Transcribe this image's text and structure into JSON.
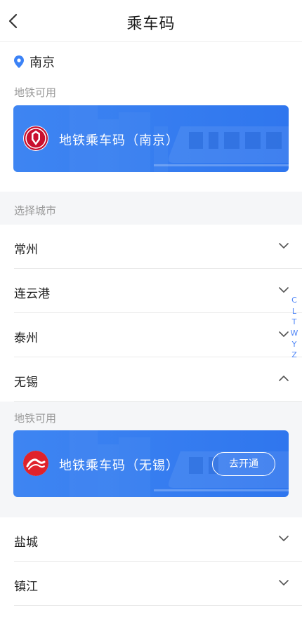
{
  "header": {
    "title": "乘车码"
  },
  "location": {
    "city": "南京"
  },
  "current_card": {
    "section_label": "地铁可用",
    "label": "地铁乘车码（南京）"
  },
  "select_city": {
    "label": "选择城市"
  },
  "cities": [
    {
      "name": "常州",
      "expanded": false
    },
    {
      "name": "连云港",
      "expanded": false
    },
    {
      "name": "泰州",
      "expanded": false
    },
    {
      "name": "无锡",
      "expanded": true
    },
    {
      "name": "盐城",
      "expanded": false
    },
    {
      "name": "镇江",
      "expanded": false
    }
  ],
  "wuxi_card": {
    "section_label": "地铁可用",
    "label": "地铁乘车码（无锡）",
    "button": "去开通"
  },
  "index_bar": [
    "C",
    "L",
    "T",
    "W",
    "Y",
    "Z"
  ],
  "colors": {
    "accent": "#3b82f6",
    "card_blue": "#2f76ee",
    "nanjing_logo": "#c8102e",
    "wuxi_logo": "#e0222b"
  },
  "icons": {
    "back": "chevron-left-icon",
    "location": "map-pin-icon",
    "expand": "chevron-down-icon",
    "collapse": "chevron-up-icon"
  }
}
